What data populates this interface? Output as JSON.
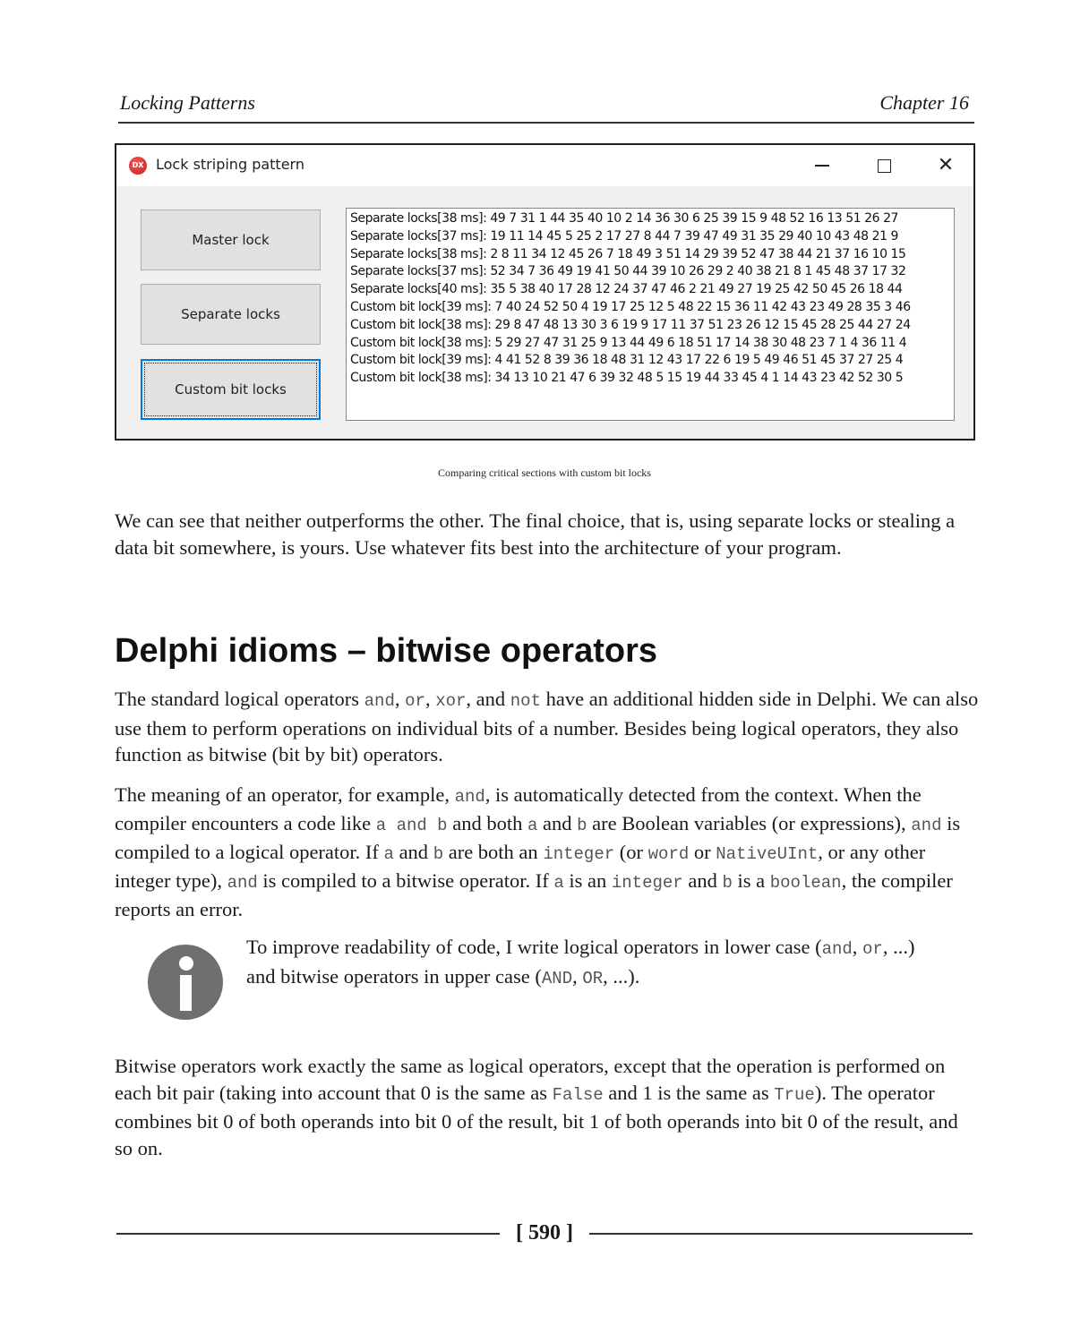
{
  "header": {
    "left": "Locking Patterns",
    "right": "Chapter 16"
  },
  "window": {
    "title": "Lock striping pattern",
    "app_icon_text": "DX",
    "controls": {
      "minimize": "minimize",
      "maximize": "maximize",
      "close": "✕"
    },
    "buttons": [
      {
        "label": "Master lock",
        "focused": false
      },
      {
        "label": "Separate locks",
        "focused": false
      },
      {
        "label": "Custom bit locks",
        "focused": true
      }
    ],
    "log": [
      "Separate locks[38 ms]: 49 7 31 1 44 35 40 10 2 14 36 30 6 25 39 15 9 48 52 16 13 51 26 27",
      "Separate locks[37 ms]: 19 11 14 45 5 25 2 17 27 8 44 7 39 47 49 31 35 29 40 10 43 48 21 9",
      "Separate locks[38 ms]: 2 8 11 34 12 45 26 7 18 49 3 51 14 29 39 52 47 38 44 21 37 16 10 15",
      "Separate locks[37 ms]: 52 34 7 36 49 19 41 50 44 39 10 26 29 2 40 38 21 8 1 45 48 37 17 32",
      "Separate locks[40 ms]: 35 5 38 40 17 28 12 24 37 47 46 2 21 49 27 19 25 42 50 45 26 18 44",
      "Custom bit lock[39 ms]: 7 40 24 52 50 4 19 17 25 12 5 48 22 15 36 11 42 43 23 49 28 35 3 46",
      "Custom bit lock[38 ms]: 29 8 47 48 13 30 3 6 19 9 17 11 37 51 23 26 12 15 45 28 25 44 27 24",
      "Custom bit lock[38 ms]: 5 29 27 47 31 25 9 13 44 49 6 18 51 17 14 38 30 48 23 7 1 4 36 11 4",
      "Custom bit lock[39 ms]: 4 41 52 8 39 36 18 48 31 12 43 17 22 6 19 5 49 46 51 45 37 27 25 4",
      "Custom bit lock[38 ms]: 34 13 10 21 47 6 39 32 48 5 15 19 44 33 45 4 1 14 43 23 42 52 30 5"
    ]
  },
  "caption": "Comparing critical sections with custom bit locks",
  "para1": "We can see that neither outperforms the other. The final choice, that is, using separate locks or stealing a data bit somewhere, is yours. Use whatever fits best into the architecture of your program.",
  "heading": "Delphi idioms – bitwise operators",
  "para2": {
    "t1": "The standard logical operators ",
    "c1": "and",
    "t2": ", ",
    "c2": "or",
    "t3": ", ",
    "c3": "xor",
    "t4": ", and ",
    "c4": "not",
    "t5": " have an additional hidden side in Delphi. We can also use them to perform operations on individual bits of a number. Besides being logical operators, they also function as bitwise (bit by bit) operators."
  },
  "para3": {
    "t1": "The meaning of an operator, for example, ",
    "c1": "and",
    "t2": ", is automatically detected from the context. When the compiler encounters a code like ",
    "c2": "a and b",
    "t3": " and both ",
    "c3": "a",
    "t4": " and ",
    "c4": "b",
    "t5": " are Boolean variables (or expressions), ",
    "c5": "and",
    "t6": " is compiled to a logical operator. If ",
    "c6": "a",
    "t7": " and ",
    "c7": "b",
    "t8": " are both an ",
    "c8": "integer",
    "t9": " (or ",
    "c9": "word",
    "t10": " or ",
    "c10": "NativeUInt",
    "t11": ", or any other integer type), ",
    "c11": "and",
    "t12": " is compiled to a bitwise operator. If ",
    "c12": "a",
    "t13": " is an ",
    "c13": "integer",
    "t14": " and ",
    "c14": "b",
    "t15": " is a ",
    "c15": "boolean",
    "t16": ", the compiler reports an error."
  },
  "note": {
    "t1": "To improve readability of code, I write logical operators in lower case (",
    "c1": "and",
    "t2": ", ",
    "c2": "or",
    "t3": ", ...) and bitwise operators in upper case (",
    "c3": "AND",
    "t4": ", ",
    "c4": "OR",
    "t5": ", ...)."
  },
  "para4": {
    "t1": "Bitwise operators work exactly the same as logical operators, except that the operation is performed on each bit pair (taking into account that 0 is the same as ",
    "c1": "False",
    "t2": " and 1 is the same as ",
    "c2": "True",
    "t3": "). The operator combines bit 0 of both operands into bit 0 of the result, bit 1 of both operands into bit 0 of the result, and so on."
  },
  "footer": {
    "page": "[ 590 ]"
  }
}
